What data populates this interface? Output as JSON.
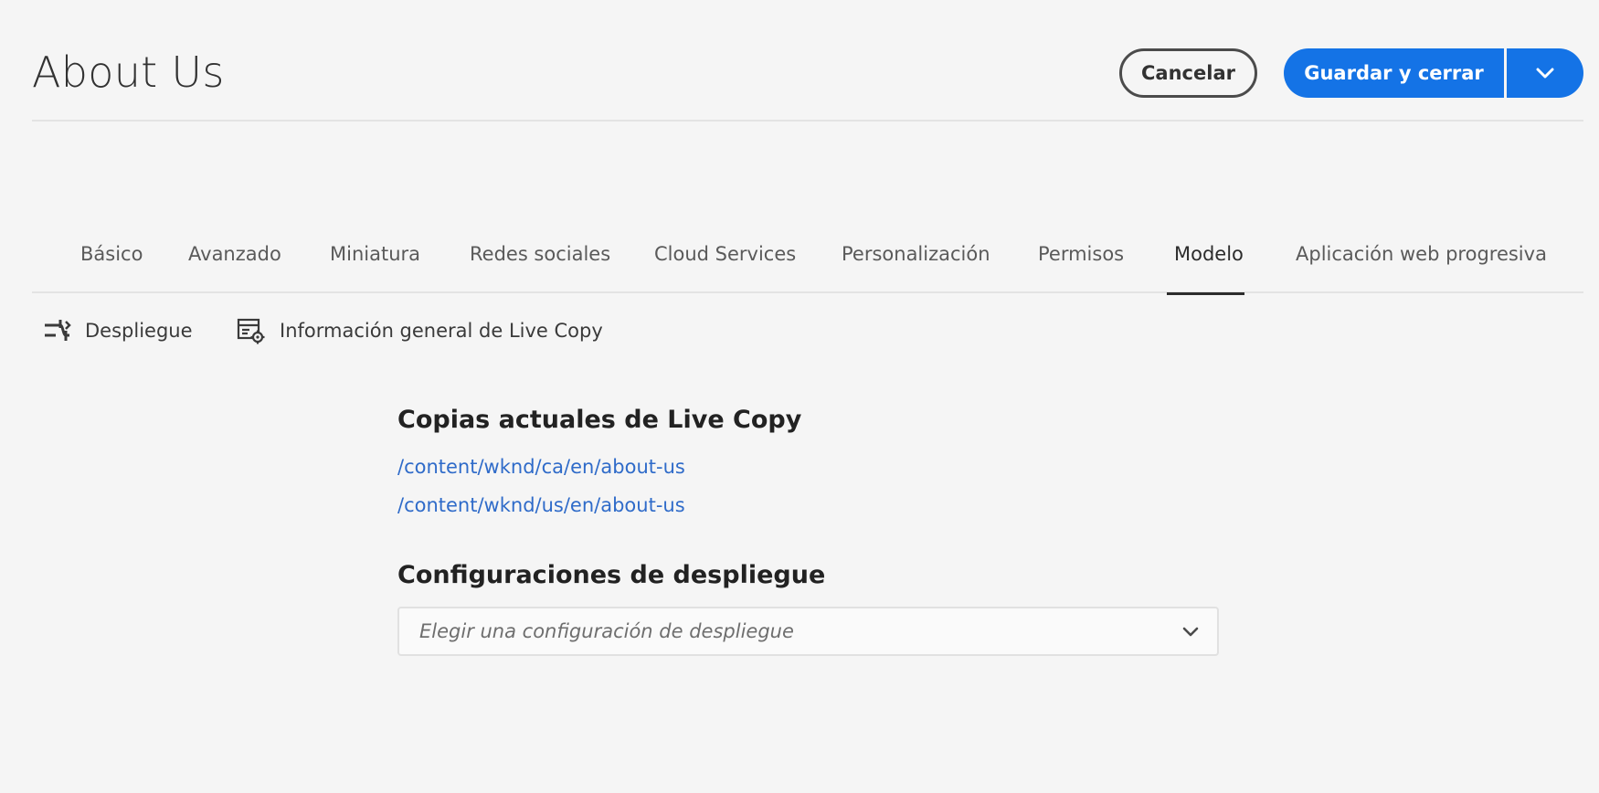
{
  "header": {
    "title": "About Us",
    "cancel_label": "Cancelar",
    "save_label": "Guardar y cerrar"
  },
  "tabs": [
    {
      "label": "Básico"
    },
    {
      "label": "Avanzado"
    },
    {
      "label": "Miniatura"
    },
    {
      "label": "Redes sociales"
    },
    {
      "label": "Cloud Services"
    },
    {
      "label": "Personalización"
    },
    {
      "label": "Permisos"
    },
    {
      "label": "Modelo",
      "active": true
    },
    {
      "label": "Aplicación web progresiva"
    }
  ],
  "actions": {
    "rollout_label": "Despliegue",
    "overview_label": "Información general de Live Copy"
  },
  "live_copies": {
    "title": "Copias actuales de Live Copy",
    "items": [
      "/content/wknd/ca/en/about-us",
      "/content/wknd/us/en/about-us"
    ]
  },
  "rollout_configs": {
    "title": "Configuraciones de despliegue",
    "placeholder": "Elegir una configuración de despliegue"
  },
  "colors": {
    "accent": "#1473e6",
    "link": "#2f6bc9",
    "background": "#f5f5f5"
  }
}
